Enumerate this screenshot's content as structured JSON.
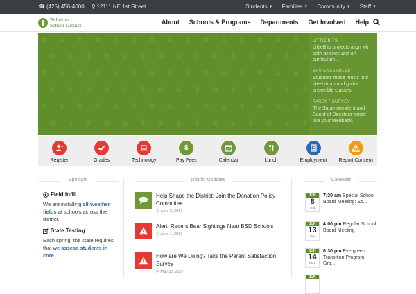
{
  "topbar": {
    "phone": "(425) 456-4000",
    "address": "12111 NE 1st Street",
    "links": [
      "Students",
      "Families",
      "Community",
      "Staff"
    ]
  },
  "logo": {
    "line1": "Bellevue",
    "line2": "School District"
  },
  "nav": {
    "items": [
      "About",
      "Schools & Programs",
      "Departments",
      "Get Involved",
      "Help"
    ]
  },
  "hero": {
    "items": [
      {
        "caption": "LITTLEBITS",
        "lines": [
          "LittleBits projects align wit",
          "both science and art",
          "curriculum..."
        ]
      },
      {
        "caption": "BHS ENSEMBLES",
        "lines": [
          "Students make music in tl",
          "steel drum and guitar",
          "ensemble classes."
        ]
      },
      {
        "caption": "PARENT SURVEY",
        "lines": [
          "The Superintendent and",
          "Board of Directors would",
          "like your feedback."
        ]
      }
    ]
  },
  "quick_links": [
    {
      "label": "Register",
      "color": "#e53935",
      "icon": "add-user-icon"
    },
    {
      "label": "Grades",
      "color": "#e53935",
      "icon": "check-icon"
    },
    {
      "label": "Technology",
      "color": "#e53935",
      "icon": "laptop-icon"
    },
    {
      "label": "Pay Fees",
      "color": "#6e9a35",
      "icon": "dollar-icon"
    },
    {
      "label": "Calendar",
      "color": "#6e9a35",
      "icon": "calendar-icon"
    },
    {
      "label": "Lunch",
      "color": "#6e9a35",
      "icon": "utensils-icon"
    },
    {
      "label": "Employment",
      "color": "#2e69b4",
      "icon": "badge-icon"
    },
    {
      "label": "Report Concern",
      "color": "#f39c12",
      "icon": "warning-icon"
    }
  ],
  "spotlight": {
    "heading": "Spotlight",
    "items": [
      {
        "title": "Field Infill",
        "icon": "soccer-ball-icon",
        "pre": "We are installing",
        "link": "all-weather fields",
        "post": "at schools across the district."
      },
      {
        "title": "State Testing",
        "icon": "edit-icon",
        "pre": "Each spring, the state requires that we",
        "link": "assess students in core",
        "post": ""
      }
    ]
  },
  "updates": {
    "heading": "District Updates",
    "items": [
      {
        "title": "Help Shape the District: Join the Donation Policy Committee",
        "date": "June 2, 2017",
        "color": "#6e9a35",
        "icon": "speech-bubble-icon"
      },
      {
        "title": "Alert: Recent Bear Sightings Near BSD Schools",
        "date": "June 1, 2017",
        "color": "#e53935",
        "icon": "warning-icon"
      },
      {
        "title": "How are We Doing? Take the Parent Satisfaction Survey",
        "date": "May 30, 2017",
        "color": "#e53935",
        "icon": "warning-icon"
      }
    ]
  },
  "calendar": {
    "heading": "Calendar",
    "events": [
      {
        "month": "JUN",
        "day": "8",
        "weekday": "Thu",
        "time": "7:30 am",
        "title": "Special School Board Meeting: Sc..."
      },
      {
        "month": "JUN",
        "day": "13",
        "weekday": "Tue",
        "time": "4:00 pm",
        "title": "Regular School Board Meeting"
      },
      {
        "month": "JUN",
        "day": "14",
        "weekday": "Wed",
        "time": "6:30 pm",
        "title": "Evergreen Transition Program Gra..."
      },
      {
        "month": "JUN",
        "day": "",
        "weekday": "",
        "time": "",
        "title": ""
      }
    ]
  }
}
